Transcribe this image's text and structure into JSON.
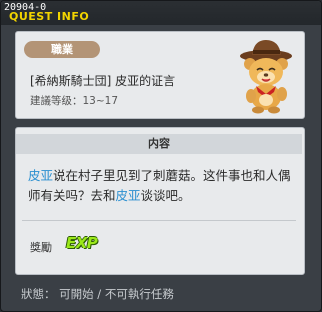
{
  "window": {
    "quest_id": "20904-0",
    "title": "QUEST INFO"
  },
  "quest": {
    "job_label": "職業",
    "name": "[希納斯騎士団] 皮亚的证言",
    "level_range": "建議等级：13~17"
  },
  "content": {
    "header": "内容",
    "desc": {
      "p1_hl": "皮亚",
      "p1": "说在村子里见到了刺蘑菇。这件事也和人偶师有关吗？去和",
      "p2_hl": "皮亚",
      "p2": "谈谈吧。"
    },
    "reward_label": "獎勵",
    "reward_exp": "EXP"
  },
  "status_text": "狀態： 可開始 / 不可執行任務",
  "colors": {
    "accent_title": "#f2d400",
    "highlight_name": "#2a8fd0",
    "exp": "#9be81a"
  }
}
